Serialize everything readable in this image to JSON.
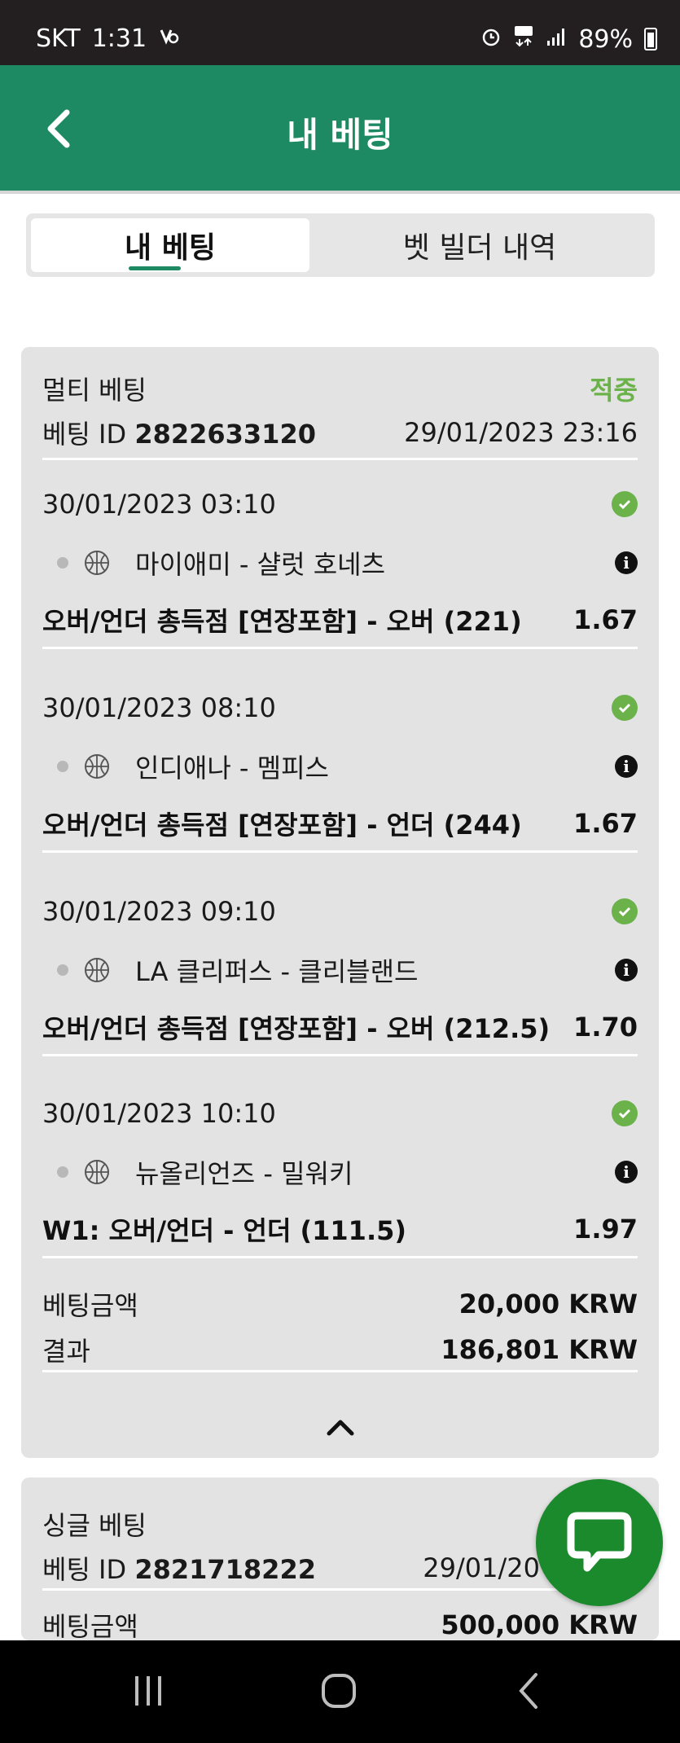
{
  "status_bar": {
    "carrier": "SKT",
    "time": "1:31",
    "battery": "89%"
  },
  "header": {
    "title": "내 베팅"
  },
  "tabs": [
    {
      "label": "내 베팅",
      "active": true
    },
    {
      "label": "벳 빌더 내역",
      "active": false
    }
  ],
  "bets": [
    {
      "type": "멀티 베팅",
      "status": "적중",
      "id_label": "베팅 ID",
      "id": "2822633120",
      "placed": "29/01/2023 23:16",
      "selections": [
        {
          "datetime": "30/01/2023 03:10",
          "match": "마이애미 - 샬럿 호네츠",
          "market": "오버/언더 총득점 [연장포함] - 오버 (221)",
          "odds": "1.67"
        },
        {
          "datetime": "30/01/2023 08:10",
          "match": "인디애나 - 멤피스",
          "market": "오버/언더 총득점 [연장포함] - 언더 (244)",
          "odds": "1.67"
        },
        {
          "datetime": "30/01/2023 09:10",
          "match": "LA 클리퍼스 - 클리블랜드",
          "market": "오버/언더 총득점 [연장포함] - 오버 (212.5)",
          "odds": "1.70"
        },
        {
          "datetime": "30/01/2023 10:10",
          "match": "뉴올리언즈 - 밀워키",
          "market": "W1: 오버/언더 - 언더 (111.5)",
          "odds": "1.97"
        }
      ],
      "stake_label": "베팅금액",
      "stake": "20,000 KRW",
      "result_label": "결과",
      "result": "186,801 KRW"
    },
    {
      "type": "싱글 베팅",
      "id_label": "베팅 ID",
      "id": "2821718222",
      "placed": "29/01/20",
      "stake_label": "베팅금액",
      "stake": "500,000 KRW"
    }
  ],
  "colors": {
    "brand_green": "#1d8a63",
    "win_green": "#6bb24a",
    "fab_green": "#1b8a2c",
    "card_bg": "#e3e3e3"
  },
  "icons": {
    "back": "chevron-left-icon",
    "success": "check-circle-icon",
    "sport": "basketball-icon",
    "info": "info-icon",
    "collapse": "chevron-up-icon",
    "chat": "chat-bubble-icon"
  }
}
